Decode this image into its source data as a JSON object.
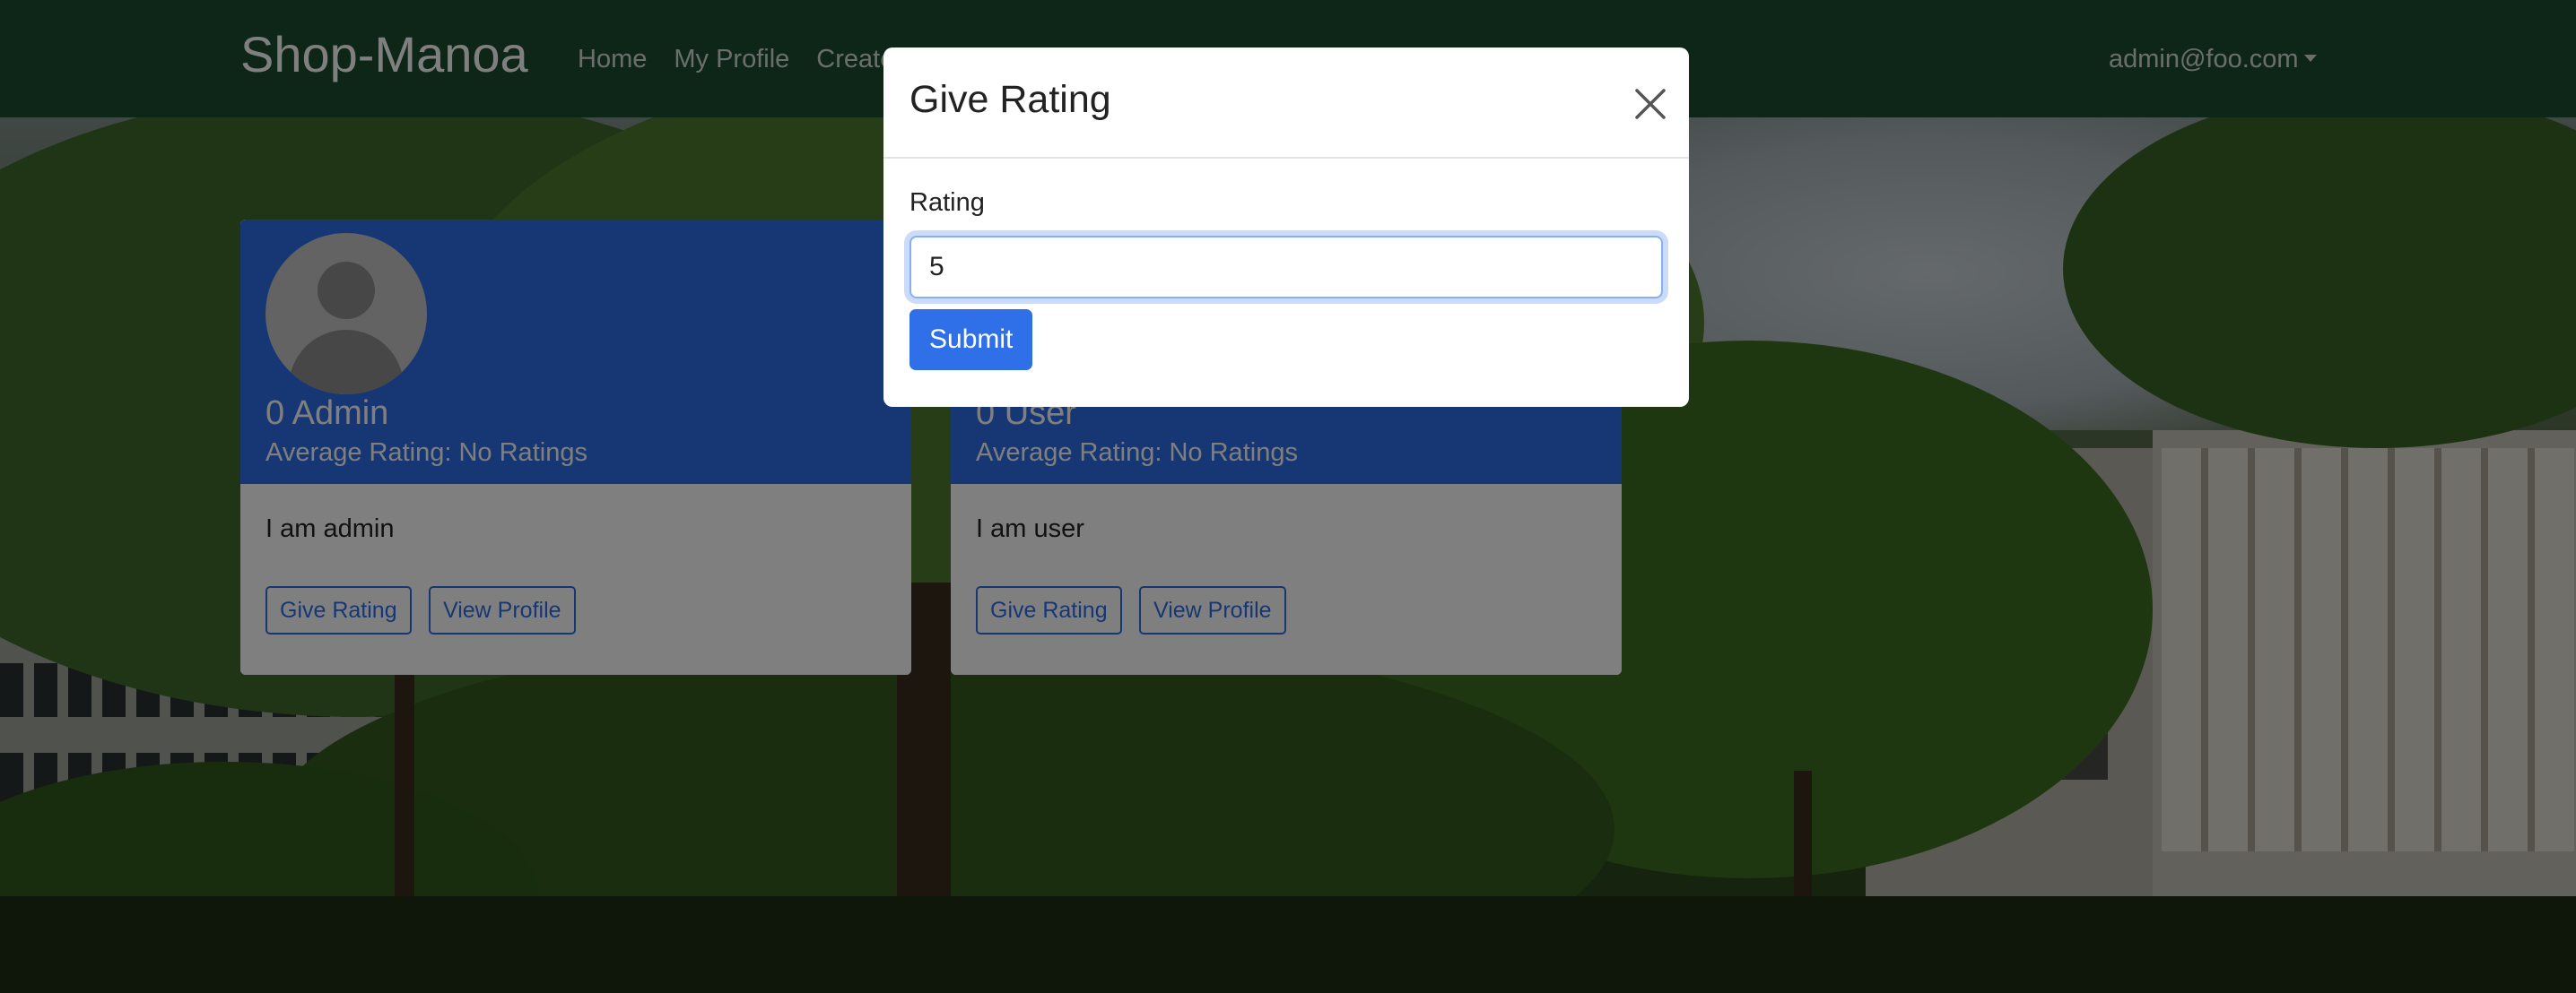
{
  "navbar": {
    "brand": "Shop-Manoa",
    "links": [
      "Home",
      "My Profile",
      "Create"
    ],
    "user": "admin@foo.com"
  },
  "cards": [
    {
      "name": "0 Admin",
      "average_rating": "Average Rating: No Ratings",
      "bio": "I am admin",
      "give_rating_label": "Give Rating",
      "view_profile_label": "View Profile"
    },
    {
      "name": "0 User",
      "average_rating": "Average Rating: No Ratings",
      "bio": "I am user",
      "give_rating_label": "Give Rating",
      "view_profile_label": "View Profile"
    }
  ],
  "modal": {
    "title": "Give Rating",
    "field_label": "Rating",
    "field_value": "5",
    "submit_label": "Submit"
  },
  "colors": {
    "navbar": "#1b4d2e",
    "accent": "#2f6fe8"
  },
  "icons": {
    "close": "close-icon",
    "avatar": "user-avatar-icon",
    "dropdown": "chevron-down-icon"
  }
}
